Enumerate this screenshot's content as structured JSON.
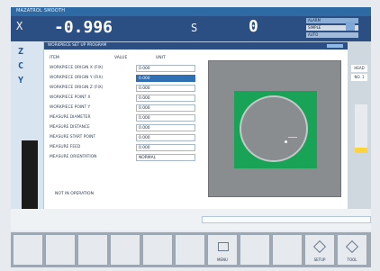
{
  "topbar": {
    "title": "MAZATROL SMOOTH"
  },
  "axisbar": {
    "axis": "X",
    "value": "-0.996",
    "spindle_label": "S",
    "feed_value": "0",
    "status_lines": [
      "ALARM",
      "SIMPLE",
      "AUTO"
    ]
  },
  "leftcol": {
    "axes": [
      "Z",
      "C",
      "Y"
    ]
  },
  "panel": {
    "title": "WORKPIECE SET UP PROGRAM",
    "header": {
      "c1": "ITEM",
      "c2": "VALUE",
      "c3": "UNIT"
    },
    "rows": [
      {
        "label": "WORKPIECE ORIGIN X (FIX)",
        "value": "0.000"
      },
      {
        "label": "WORKPIECE ORIGIN Y (FIX)",
        "value": "0.000",
        "active": true
      },
      {
        "label": "WORKPIECE ORIGIN Z (FIX)",
        "value": "0.000"
      },
      {
        "label": "WORKPIECE POINT X",
        "value": "0.000"
      },
      {
        "label": "WORKPIECE POINT Y",
        "value": "0.000"
      },
      {
        "label": "MEASURE DIAMETER",
        "value": "0.000"
      },
      {
        "label": "MEASURE DISTANCE",
        "value": "0.000"
      },
      {
        "label": "MEASURE START POINT",
        "value": "0.000"
      },
      {
        "label": "MEASURE FEED",
        "value": "0.000"
      },
      {
        "label": "MEASURE ORIENTATION",
        "value": "NORMAL"
      }
    ],
    "status": "NOT IN OPERATION"
  },
  "rightcol": {
    "tag1": "HEAD",
    "tag2": "NO. 1"
  },
  "fkeys": [
    {
      "label": ""
    },
    {
      "label": ""
    },
    {
      "label": ""
    },
    {
      "label": ""
    },
    {
      "label": ""
    },
    {
      "label": ""
    },
    {
      "label": "MENU"
    },
    {
      "label": ""
    },
    {
      "label": ""
    },
    {
      "label": "SETUP"
    },
    {
      "label": "TOOL"
    }
  ]
}
